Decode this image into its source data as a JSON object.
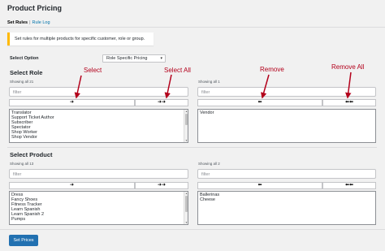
{
  "header": {
    "title": "Product Pricing"
  },
  "tabs": {
    "active": "Set Rules",
    "separator": "|",
    "link": "Rule Log"
  },
  "notice": {
    "text": "Set rules for multiple products for specific customer, role or group."
  },
  "select_option": {
    "label": "Select Option",
    "value": "Role Specific Pricing"
  },
  "role": {
    "title": "Select Role",
    "left": {
      "showing": "Showing all 21",
      "filter_placeholder": "filter",
      "items": [
        "Translator",
        "Support Ticket Author",
        "Subscriber",
        "Spectator",
        "Shop Worker",
        "Shop Vendor"
      ]
    },
    "right": {
      "showing": "Showing all 1",
      "filter_placeholder": "filter",
      "items": [
        "Vendor"
      ]
    }
  },
  "product": {
    "title": "Select Product",
    "left": {
      "showing": "Showing all 13",
      "filter_placeholder": "filter",
      "items": [
        "Dress",
        "Fancy Shoes",
        "Fitness Tracker",
        "Learn Spanish",
        "Learn Spanish 2",
        "Pumps"
      ]
    },
    "right": {
      "showing": "Showing all 2",
      "filter_placeholder": "filter",
      "items": [
        "Ballerinas",
        "Cheese"
      ]
    }
  },
  "buttons": {
    "move_one_right": "➜",
    "move_all_right": "➜➜",
    "move_one_left": "⬅",
    "move_all_left": "⬅⬅",
    "set_prices": "Set Prices"
  },
  "annotations": {
    "select": "Select",
    "select_all": "Select All",
    "remove": "Remove",
    "remove_all": "Remove All"
  },
  "colors": {
    "accent": "#2271b1",
    "notice_border": "#ffb900",
    "annotation": "#b3001b",
    "link": "#0073aa"
  }
}
